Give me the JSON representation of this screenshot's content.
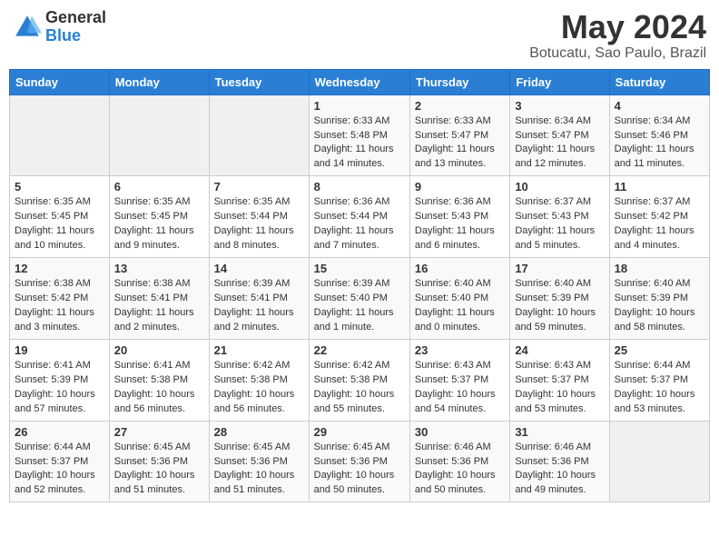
{
  "logo": {
    "general": "General",
    "blue": "Blue"
  },
  "title": "May 2024",
  "subtitle": "Botucatu, Sao Paulo, Brazil",
  "headers": [
    "Sunday",
    "Monday",
    "Tuesday",
    "Wednesday",
    "Thursday",
    "Friday",
    "Saturday"
  ],
  "weeks": [
    [
      {
        "day": "",
        "info": ""
      },
      {
        "day": "",
        "info": ""
      },
      {
        "day": "",
        "info": ""
      },
      {
        "day": "1",
        "info": "Sunrise: 6:33 AM\nSunset: 5:48 PM\nDaylight: 11 hours and 14 minutes."
      },
      {
        "day": "2",
        "info": "Sunrise: 6:33 AM\nSunset: 5:47 PM\nDaylight: 11 hours and 13 minutes."
      },
      {
        "day": "3",
        "info": "Sunrise: 6:34 AM\nSunset: 5:47 PM\nDaylight: 11 hours and 12 minutes."
      },
      {
        "day": "4",
        "info": "Sunrise: 6:34 AM\nSunset: 5:46 PM\nDaylight: 11 hours and 11 minutes."
      }
    ],
    [
      {
        "day": "5",
        "info": "Sunrise: 6:35 AM\nSunset: 5:45 PM\nDaylight: 11 hours and 10 minutes."
      },
      {
        "day": "6",
        "info": "Sunrise: 6:35 AM\nSunset: 5:45 PM\nDaylight: 11 hours and 9 minutes."
      },
      {
        "day": "7",
        "info": "Sunrise: 6:35 AM\nSunset: 5:44 PM\nDaylight: 11 hours and 8 minutes."
      },
      {
        "day": "8",
        "info": "Sunrise: 6:36 AM\nSunset: 5:44 PM\nDaylight: 11 hours and 7 minutes."
      },
      {
        "day": "9",
        "info": "Sunrise: 6:36 AM\nSunset: 5:43 PM\nDaylight: 11 hours and 6 minutes."
      },
      {
        "day": "10",
        "info": "Sunrise: 6:37 AM\nSunset: 5:43 PM\nDaylight: 11 hours and 5 minutes."
      },
      {
        "day": "11",
        "info": "Sunrise: 6:37 AM\nSunset: 5:42 PM\nDaylight: 11 hours and 4 minutes."
      }
    ],
    [
      {
        "day": "12",
        "info": "Sunrise: 6:38 AM\nSunset: 5:42 PM\nDaylight: 11 hours and 3 minutes."
      },
      {
        "day": "13",
        "info": "Sunrise: 6:38 AM\nSunset: 5:41 PM\nDaylight: 11 hours and 2 minutes."
      },
      {
        "day": "14",
        "info": "Sunrise: 6:39 AM\nSunset: 5:41 PM\nDaylight: 11 hours and 2 minutes."
      },
      {
        "day": "15",
        "info": "Sunrise: 6:39 AM\nSunset: 5:40 PM\nDaylight: 11 hours and 1 minute."
      },
      {
        "day": "16",
        "info": "Sunrise: 6:40 AM\nSunset: 5:40 PM\nDaylight: 11 hours and 0 minutes."
      },
      {
        "day": "17",
        "info": "Sunrise: 6:40 AM\nSunset: 5:39 PM\nDaylight: 10 hours and 59 minutes."
      },
      {
        "day": "18",
        "info": "Sunrise: 6:40 AM\nSunset: 5:39 PM\nDaylight: 10 hours and 58 minutes."
      }
    ],
    [
      {
        "day": "19",
        "info": "Sunrise: 6:41 AM\nSunset: 5:39 PM\nDaylight: 10 hours and 57 minutes."
      },
      {
        "day": "20",
        "info": "Sunrise: 6:41 AM\nSunset: 5:38 PM\nDaylight: 10 hours and 56 minutes."
      },
      {
        "day": "21",
        "info": "Sunrise: 6:42 AM\nSunset: 5:38 PM\nDaylight: 10 hours and 56 minutes."
      },
      {
        "day": "22",
        "info": "Sunrise: 6:42 AM\nSunset: 5:38 PM\nDaylight: 10 hours and 55 minutes."
      },
      {
        "day": "23",
        "info": "Sunrise: 6:43 AM\nSunset: 5:37 PM\nDaylight: 10 hours and 54 minutes."
      },
      {
        "day": "24",
        "info": "Sunrise: 6:43 AM\nSunset: 5:37 PM\nDaylight: 10 hours and 53 minutes."
      },
      {
        "day": "25",
        "info": "Sunrise: 6:44 AM\nSunset: 5:37 PM\nDaylight: 10 hours and 53 minutes."
      }
    ],
    [
      {
        "day": "26",
        "info": "Sunrise: 6:44 AM\nSunset: 5:37 PM\nDaylight: 10 hours and 52 minutes."
      },
      {
        "day": "27",
        "info": "Sunrise: 6:45 AM\nSunset: 5:36 PM\nDaylight: 10 hours and 51 minutes."
      },
      {
        "day": "28",
        "info": "Sunrise: 6:45 AM\nSunset: 5:36 PM\nDaylight: 10 hours and 51 minutes."
      },
      {
        "day": "29",
        "info": "Sunrise: 6:45 AM\nSunset: 5:36 PM\nDaylight: 10 hours and 50 minutes."
      },
      {
        "day": "30",
        "info": "Sunrise: 6:46 AM\nSunset: 5:36 PM\nDaylight: 10 hours and 50 minutes."
      },
      {
        "day": "31",
        "info": "Sunrise: 6:46 AM\nSunset: 5:36 PM\nDaylight: 10 hours and 49 minutes."
      },
      {
        "day": "",
        "info": ""
      }
    ]
  ]
}
